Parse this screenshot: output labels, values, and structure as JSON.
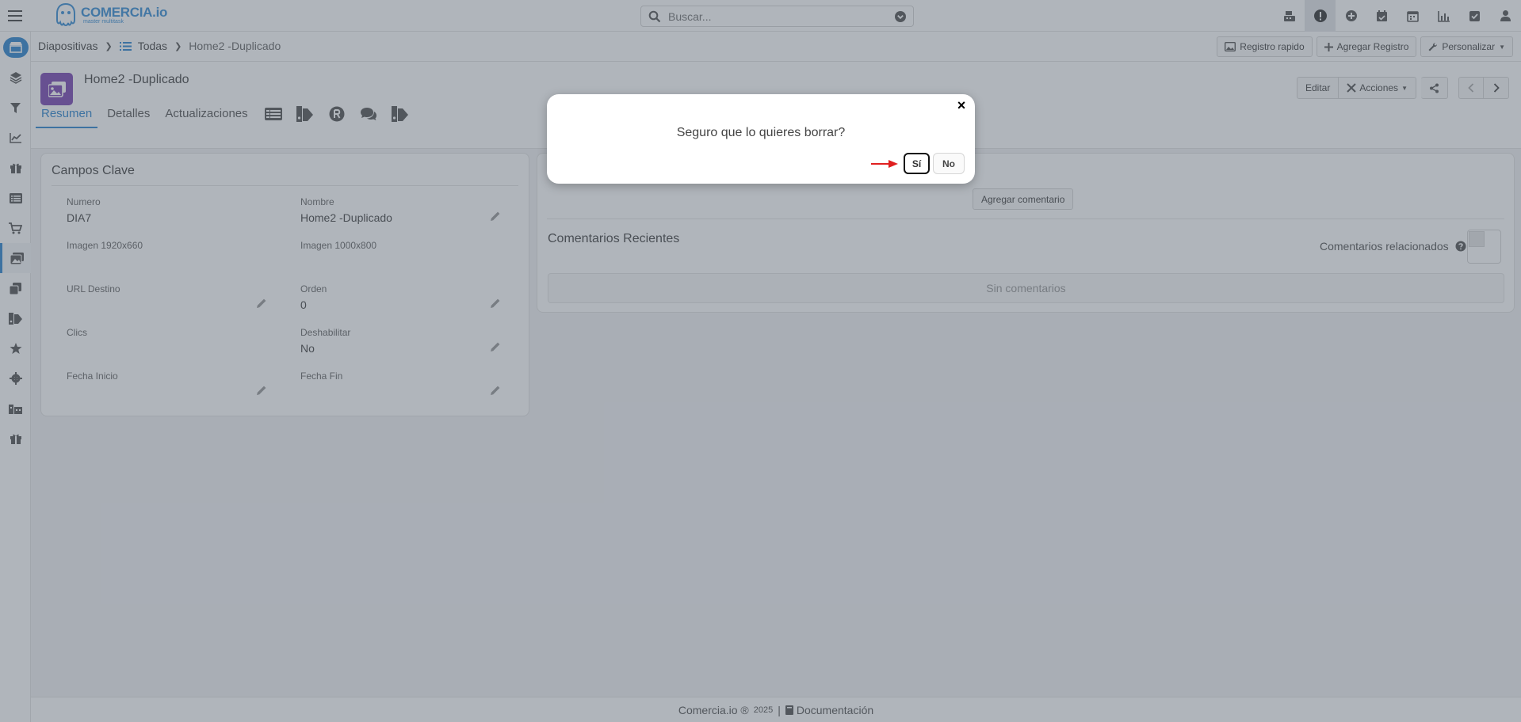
{
  "app": {
    "logo_title": "COMERCIA.io",
    "logo_subtitle": "master multitask"
  },
  "search": {
    "placeholder": "Buscar..."
  },
  "topbar": {
    "icons": [
      "cash-register-icon",
      "alert-icon",
      "plus-circle-icon",
      "calendar-check-icon",
      "calendar-icon",
      "bar-chart-icon",
      "checkbox-icon",
      "user-icon"
    ],
    "active_icon": "alert-icon"
  },
  "sidebar": {
    "items": [
      "store-icon",
      "layers-icon",
      "filter-icon",
      "line-chart-icon",
      "gift-icon",
      "list-icon",
      "cart-icon",
      "images-icon",
      "copy-icon",
      "tags-icon",
      "star-icon",
      "gear-icon",
      "buildings-icon",
      "gift-icon"
    ],
    "active_index": 7
  },
  "breadcrumb": {
    "root": "Diapositivas",
    "list": "Todas",
    "current": "Home2 -Duplicado"
  },
  "crumb_actions": {
    "quick": "Registro rapido",
    "add": "Agregar Registro",
    "customize": "Personalizar"
  },
  "record": {
    "title": "Home2 -Duplicado",
    "edit": "Editar",
    "actions": "Acciones"
  },
  "tabs": [
    "Resumen",
    "Detalles",
    "Actualizaciones"
  ],
  "tab_icons": [
    "table-icon",
    "tags-icon",
    "r-badge-icon",
    "comments-icon",
    "tags-icon"
  ],
  "key_fields": {
    "title": "Campos Clave",
    "numero_label": "Numero",
    "numero_value": "DIA7",
    "nombre_label": "Nombre",
    "nombre_value": "Home2 -Duplicado",
    "img1_label": "Imagen 1920x660",
    "img2_label": "Imagen 1000x800",
    "url_label": "URL Destino",
    "orden_label": "Orden",
    "orden_value": "0",
    "clics_label": "Clics",
    "deshabilitar_label": "Deshabilitar",
    "deshabilitar_value": "No",
    "inicio_label": "Fecha Inicio",
    "fin_label": "Fecha Fin"
  },
  "comments": {
    "add": "Agregar comentario",
    "recent_title": "Comentarios Recientes",
    "related_label": "Comentarios relacionados",
    "empty": "Sin comentarios"
  },
  "footer": {
    "brand": "Comercia.io ®",
    "year": "2025",
    "sep": "|",
    "docs": "Documentación"
  },
  "modal": {
    "message": "Seguro que lo quieres borrar?",
    "yes": "Sí",
    "no": "No",
    "close": "×"
  },
  "colors": {
    "accent": "#2f86cf",
    "avatar": "#7b47b3",
    "arrow": "#e02020"
  }
}
